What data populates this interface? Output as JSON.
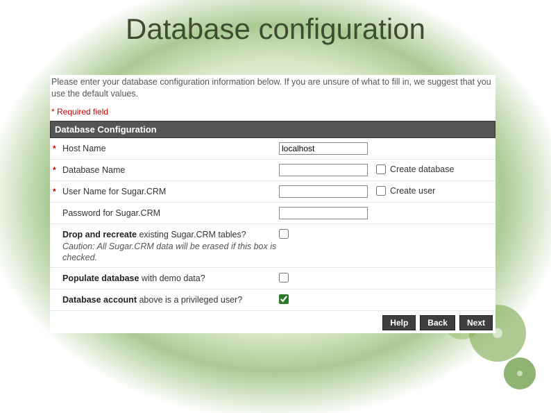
{
  "title": "Database configuration",
  "intro": "Please enter your database configuration information below. If you are unsure of what to fill in, we suggest that you use the default values.",
  "required_note": "* Required field",
  "section_header": "Database Configuration",
  "fields": {
    "host_name": {
      "asterisk": "*",
      "label": "Host Name",
      "value": "localhost"
    },
    "database_name": {
      "asterisk": "*",
      "label": "Database Name",
      "value": "",
      "extra_label": "Create database",
      "extra_checked": false
    },
    "user_name": {
      "asterisk": "*",
      "label": "User Name for Sugar.CRM",
      "value": "",
      "extra_label": "Create user",
      "extra_checked": false
    },
    "password": {
      "asterisk": "",
      "label": "Password for Sugar.CRM",
      "value": ""
    },
    "drop_tables": {
      "asterisk": "",
      "label_bold": "Drop and recreate",
      "label_rest": " existing Sugar.CRM tables?",
      "caution": "Caution: All Sugar.CRM data will be erased if this box is checked.",
      "checked": false
    },
    "demo_data": {
      "asterisk": "",
      "label_bold": "Populate database",
      "label_rest": " with demo data?",
      "checked": false
    },
    "priv_user": {
      "asterisk": "",
      "label_bold": "Database account",
      "label_rest": " above is a privileged user?",
      "checked": true
    }
  },
  "buttons": {
    "help": "Help",
    "back": "Back",
    "next": "Next"
  }
}
